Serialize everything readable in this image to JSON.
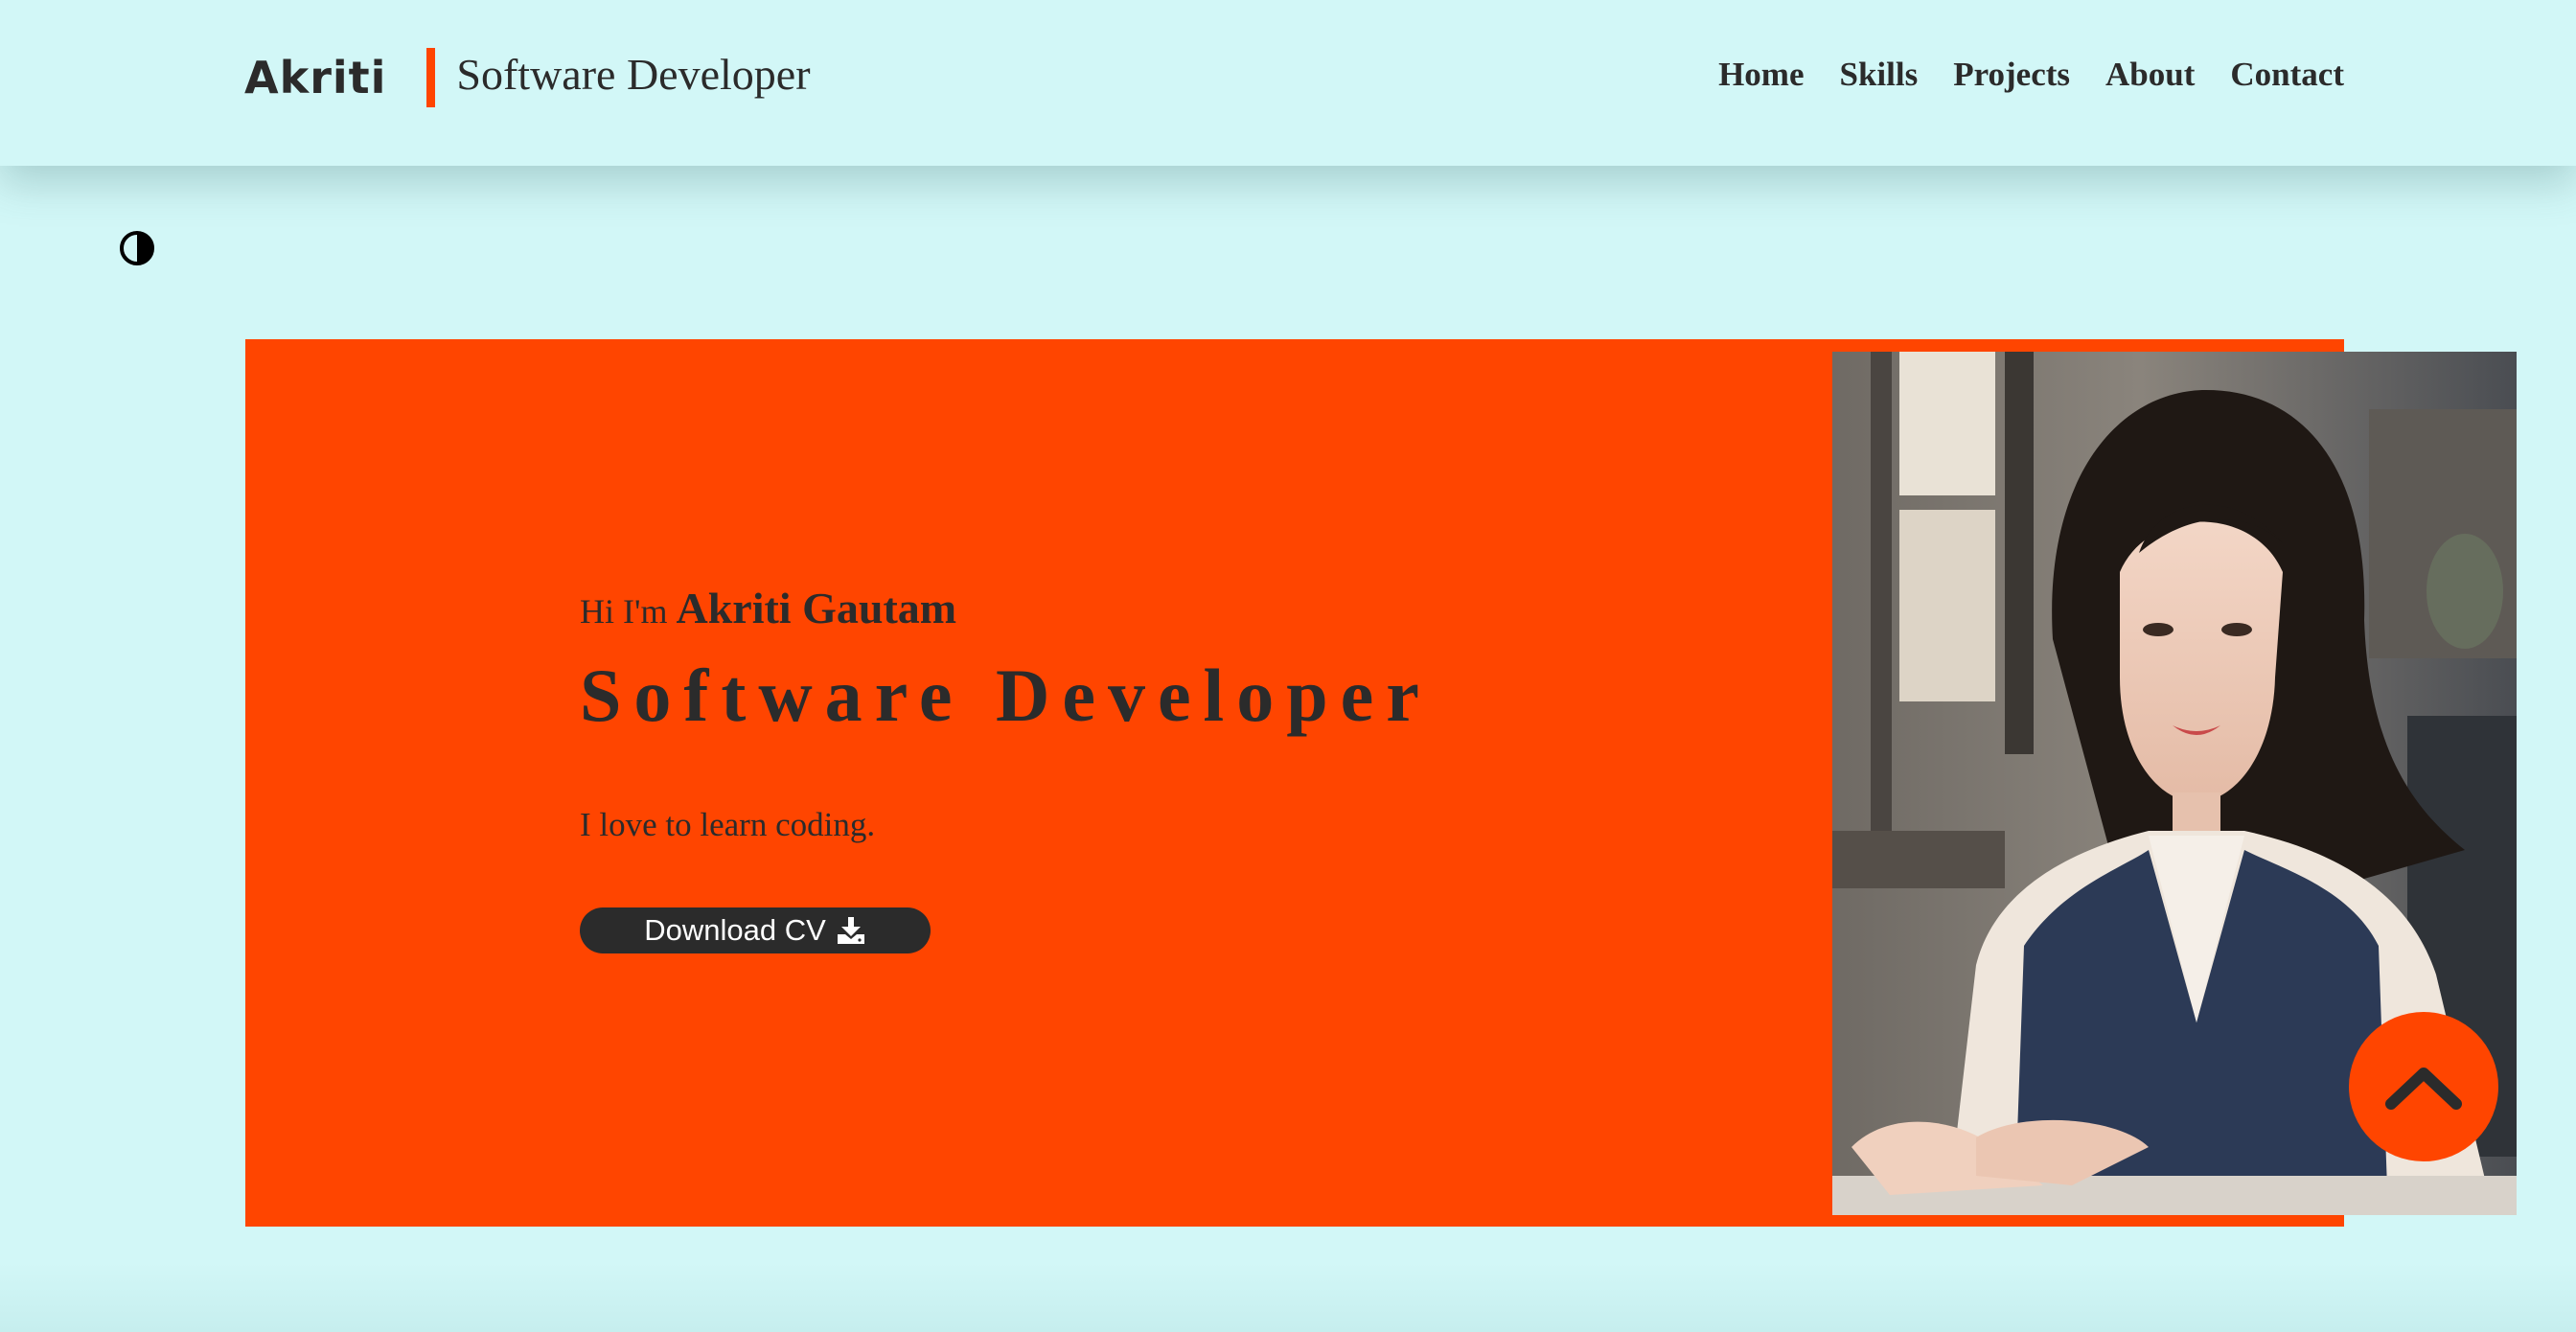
{
  "header": {
    "brand_name": "Akriti",
    "tagline": "Software Developer",
    "nav": [
      {
        "label": "Home"
      },
      {
        "label": "Skills"
      },
      {
        "label": "Projects"
      },
      {
        "label": "About"
      },
      {
        "label": "Contact"
      }
    ]
  },
  "theme_toggle": {
    "icon": "half-circle-contrast-icon"
  },
  "hero": {
    "greeting_prefix": "Hi I'm",
    "name": "Akriti Gautam",
    "role": "Software Developer",
    "blurb": "I love to learn coding.",
    "cv_button_label": "Download CV",
    "cv_button_icon": "download-icon",
    "photo_icon": "portrait-photo"
  },
  "scroll_top": {
    "icon": "chevron-up-icon"
  },
  "colors": {
    "background": "#d2f7f7",
    "accent": "#ff4500",
    "text": "#2b2b2b",
    "button_bg": "#2b2b2b",
    "button_text": "#ffffff"
  }
}
